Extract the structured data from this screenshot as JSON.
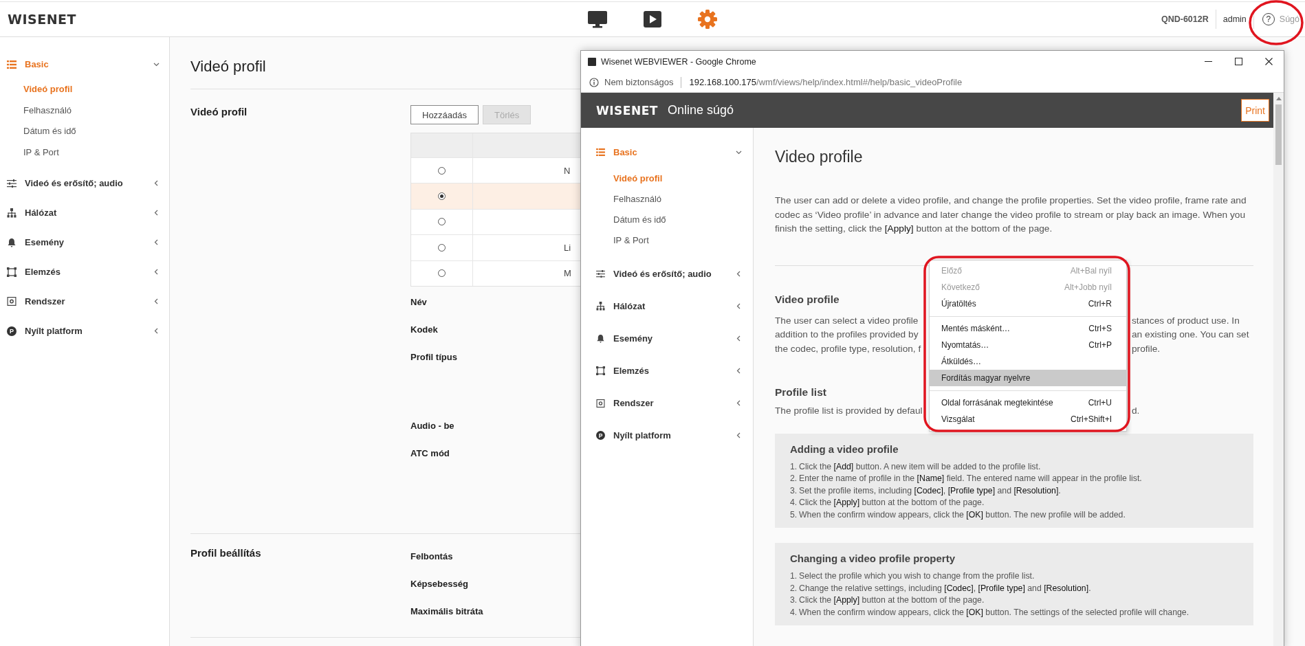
{
  "topbar": {
    "logo": "WISENET",
    "nav": [
      {
        "kind": "monitor",
        "selected": false
      },
      {
        "kind": "play",
        "selected": false
      },
      {
        "kind": "gear",
        "selected": true
      }
    ],
    "model": "QND-6012R",
    "user": "admin",
    "help_glyph": "?",
    "help": "Súgó"
  },
  "sidebar": {
    "groups": [
      {
        "label": "Basic",
        "kind": "list",
        "selected": true,
        "expanded": true,
        "children": [
          {
            "label": "Videó profil",
            "selected": true
          },
          {
            "label": "Felhasználó",
            "selected": false
          },
          {
            "label": "Dátum és idő",
            "selected": false
          },
          {
            "label": "IP & Port",
            "selected": false
          }
        ]
      },
      {
        "label": "Videó és erősítő; audio",
        "kind": "sliders",
        "selected": false,
        "expanded": false
      },
      {
        "label": "Hálózat",
        "kind": "network",
        "selected": false,
        "expanded": false
      },
      {
        "label": "Esemény",
        "kind": "bell",
        "selected": false,
        "expanded": false
      },
      {
        "label": "Elemzés",
        "kind": "frame",
        "selected": false,
        "expanded": false
      },
      {
        "label": "Rendszer",
        "kind": "chip",
        "selected": false,
        "expanded": false
      },
      {
        "label": "Nyílt platform",
        "kind": "badge",
        "badge": "P",
        "selected": false,
        "expanded": false
      }
    ]
  },
  "page": {
    "title": "Videó profil",
    "sections": [
      {
        "label": "Videó profil",
        "buttons": [
          {
            "label": "Hozzáadás",
            "disabled": false
          },
          {
            "label": "Törlés",
            "disabled": true
          }
        ],
        "rows": [
          {
            "selected": false,
            "name": "N"
          },
          {
            "selected": true
          },
          {
            "selected": false
          },
          {
            "selected": false,
            "name": "Li"
          },
          {
            "selected": false,
            "name": "M"
          }
        ],
        "fields": [
          {
            "label": "Név",
            "kind": "single"
          },
          {
            "label": "Kodek",
            "kind": "single"
          },
          {
            "label": "Profil típus",
            "kind": "options"
          },
          {
            "label": "Audio - be",
            "kind": "single"
          },
          {
            "label": "ATC mód",
            "kind": "options"
          }
        ]
      },
      {
        "label": "Profil beállítás",
        "fields": [
          {
            "label": "Felbontás",
            "kind": "single"
          },
          {
            "label": "Képsebesség",
            "kind": "single"
          },
          {
            "label": "Maximális bitráta",
            "kind": "single"
          }
        ]
      }
    ]
  },
  "help_window": {
    "title": "Wisenet WEBVIEWER - Google Chrome",
    "security": "Nem biztonságos",
    "url_host": "192.168.100.175",
    "url_path": "/wmf/views/help/index.html#/help/basic_videoProfile",
    "logo": "WISENET",
    "heading": "Online súgó",
    "print": "Print",
    "sidebar": {
      "groups": [
        {
          "label": "Basic",
          "kind": "list",
          "selected": true,
          "expanded": true,
          "children": [
            {
              "label": "Videó profil",
              "selected": true
            },
            {
              "label": "Felhasználó",
              "selected": false
            },
            {
              "label": "Dátum és idő",
              "selected": false
            },
            {
              "label": "IP & Port",
              "selected": false
            }
          ]
        },
        {
          "label": "Videó és erősítő; audio",
          "kind": "sliders",
          "selected": false,
          "expanded": false
        },
        {
          "label": "Hálózat",
          "kind": "network",
          "selected": false,
          "expanded": false
        },
        {
          "label": "Esemény",
          "kind": "bell",
          "selected": false,
          "expanded": false
        },
        {
          "label": "Elemzés",
          "kind": "frame",
          "selected": false,
          "expanded": false
        },
        {
          "label": "Rendszer",
          "kind": "chip",
          "selected": false,
          "expanded": false
        },
        {
          "label": "Nyílt platform",
          "kind": "badge",
          "badge": "P",
          "selected": false,
          "expanded": false
        }
      ]
    },
    "content": {
      "title": "Video profile",
      "intro": "The user can add or delete a video profile, and change the profile properties. Set the video profile, frame rate and codec as ‘Video profile’ in advance and later change the video profile to stream or play back an image. When you finish the setting, click the **[Apply]** button at the bottom of the page.",
      "sections": [
        {
          "heading": "Video profile",
          "lines": [
            {
              "left": "The user can select a video profile",
              "right": "stances of product use. In"
            },
            {
              "left": "addition to the profiles provided by",
              "right": "an existing one. You can set"
            },
            {
              "left": "the codec, profile type, resolution, f",
              "right": "profile."
            }
          ]
        },
        {
          "heading": "Profile list",
          "lines": [
            {
              "left": "The profile list is provided by defaul",
              "right": "d."
            }
          ]
        }
      ],
      "boxes": [
        {
          "title": "Adding a video profile",
          "steps": [
            {
              "number": "1.",
              "text": "Click the **[Add]** button. A new item will be added to the profile list."
            },
            {
              "number": "2.",
              "text": "Enter the name of profile in the **[Name]** field. The entered name will appear in the profile list."
            },
            {
              "number": "3.",
              "text": "Set the profile items, including **[Codec]**, **[Profile type]** and **[Resolution]**."
            },
            {
              "number": "4.",
              "text": "Click the **[Apply]** button at the bottom of the page."
            },
            {
              "number": "5.",
              "text": "When the confirm window appears, click the **[OK]** button. The new profile will be added."
            }
          ]
        },
        {
          "title": "Changing a video profile property",
          "steps": [
            {
              "number": "1.",
              "text": "Select the profile which you wish to change from the profile list."
            },
            {
              "number": "2.",
              "text": "Change the relative settings, including **[Codec]**, **[Profile type]** and **[Resolution]**."
            },
            {
              "number": "3.",
              "text": "Click the **[Apply]** button at the bottom of the page."
            },
            {
              "number": "4.",
              "text": "When the confirm window appears, click the **[OK]** button. The settings of the selected profile will change."
            }
          ]
        }
      ]
    },
    "context_menu": {
      "groups": [
        [
          {
            "label": "Előző",
            "shortcut": "Alt+Bal nyíl",
            "disabled": true,
            "selected": false
          },
          {
            "label": "Következő",
            "shortcut": "Alt+Jobb nyíl",
            "disabled": true,
            "selected": false
          },
          {
            "label": "Újratöltés",
            "shortcut": "Ctrl+R",
            "disabled": false,
            "selected": false
          }
        ],
        [
          {
            "label": "Mentés másként…",
            "shortcut": "Ctrl+S",
            "disabled": false,
            "selected": false
          },
          {
            "label": "Nyomtatás…",
            "shortcut": "Ctrl+P",
            "disabled": false,
            "selected": false
          },
          {
            "label": "Átküldés…",
            "disabled": false,
            "selected": false
          },
          {
            "label": "Fordítás magyar nyelvre",
            "disabled": false,
            "selected": true
          }
        ],
        [
          {
            "label": "Oldal forrásának megtekintése",
            "shortcut": "Ctrl+U",
            "disabled": false,
            "selected": false
          },
          {
            "label": "Vizsgálat",
            "shortcut": "Ctrl+Shift+I",
            "disabled": false,
            "selected": false
          }
        ]
      ]
    }
  }
}
